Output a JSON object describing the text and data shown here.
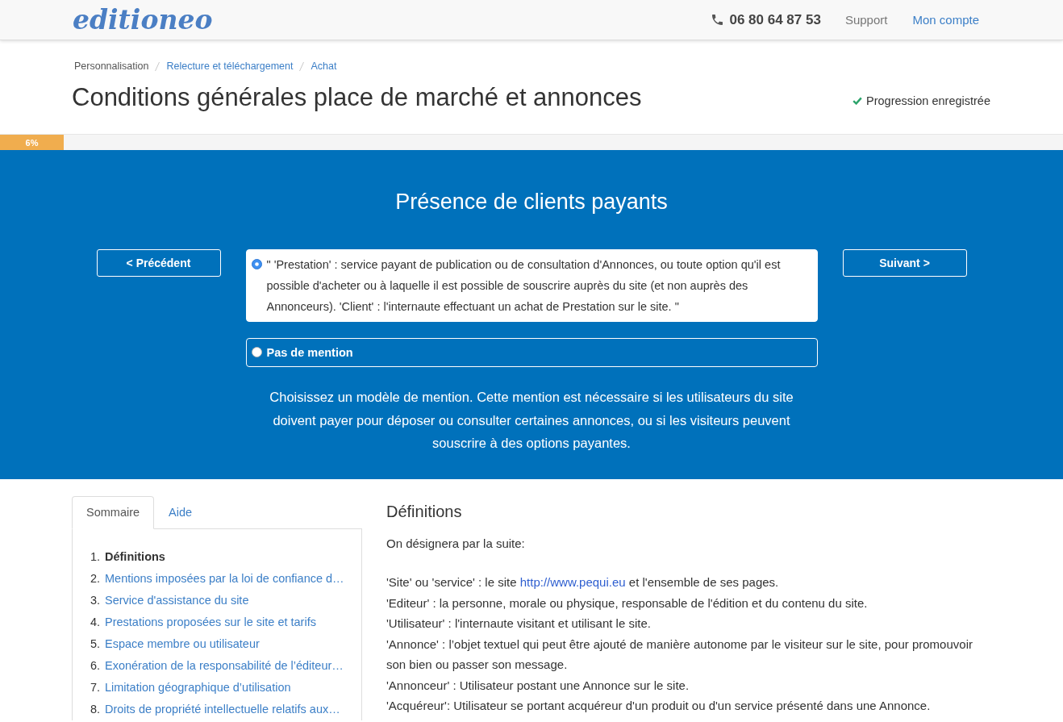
{
  "header": {
    "logo": "editioneo",
    "phone": "06 80 64 87 53",
    "links": [
      {
        "label": "Support",
        "kind": "muted"
      },
      {
        "label": "Mon compte",
        "kind": "primary"
      }
    ]
  },
  "breadcrumb": [
    {
      "label": "Personnalisation",
      "current": true
    },
    {
      "label": "Relecture et téléchargement",
      "current": false
    },
    {
      "label": "Achat",
      "current": false
    }
  ],
  "page": {
    "title": "Conditions générales place de marché et annonces",
    "saved_status": "Progression enregistrée"
  },
  "progress": {
    "level": 0.06,
    "label": "6%"
  },
  "step": {
    "title": "Présence de clients payants",
    "prev_button": "< Précédent",
    "next_button": "Suivant >",
    "options": [
      {
        "text": "\" 'Prestation' : service payant de publication ou de consultation d'Annonces, ou toute option qu'il est possible d'acheter ou à laquelle il est possible de souscrire auprès du site (et non auprès des Annonceurs). 'Client' : l'internaute effectuant un achat de Prestation sur le site. \"",
        "selected": true
      },
      {
        "text": "Pas de mention",
        "selected": false
      }
    ],
    "help": "Choisissez un modèle de mention. Cette mention est nécessaire si les utilisateurs du site doivent payer pour déposer ou consulter certaines annonces, ou si les visiteurs peuvent souscrire à des options payantes."
  },
  "sidebar": {
    "tabs": [
      {
        "label": "Sommaire",
        "selected": true
      },
      {
        "label": "Aide",
        "selected": false
      }
    ],
    "items": [
      {
        "number": "1.",
        "label": "Définitions",
        "selected": true
      },
      {
        "number": "2.",
        "label": "Mentions imposées par la loi de confiance d…",
        "selected": false
      },
      {
        "number": "3.",
        "label": "Service d'assistance du site",
        "selected": false
      },
      {
        "number": "4.",
        "label": "Prestations proposées sur le site et tarifs",
        "selected": false
      },
      {
        "number": "5.",
        "label": "Espace membre ou utilisateur",
        "selected": false
      },
      {
        "number": "6.",
        "label": "Exonération de la responsabilité de l’éditeur…",
        "selected": false
      },
      {
        "number": "7.",
        "label": "Limitation géographique d’utilisation",
        "selected": false
      },
      {
        "number": "8.",
        "label": "Droits de propriété intellectuelle relatifs aux…",
        "selected": false
      }
    ]
  },
  "content": {
    "heading": "Définitions",
    "intro": "On désignera par la suite:",
    "definitions": [
      {
        "text": "'Site' ou 'service' : le site",
        "link": "http://www.pequi.eu",
        "after": "et l'ensemble de ses pages."
      },
      {
        "text": "'Editeur' : la personne, morale ou physique, responsable de l'édition et du contenu du site."
      },
      {
        "text": "'Utilisateur' : l'internaute visitant et utilisant le site."
      },
      {
        "text": "'Annonce' : l’objet textuel qui peut être ajouté de manière autonome par le visiteur sur le site, pour promouvoir son bien ou passer son message."
      },
      {
        "text": "'Annonceur' : Utilisateur postant une Annonce sur le site."
      },
      {
        "text": "'Acquéreur': Utilisateur se portant acquéreur d'un produit ou d'un service présenté dans une Annonce."
      }
    ]
  }
}
